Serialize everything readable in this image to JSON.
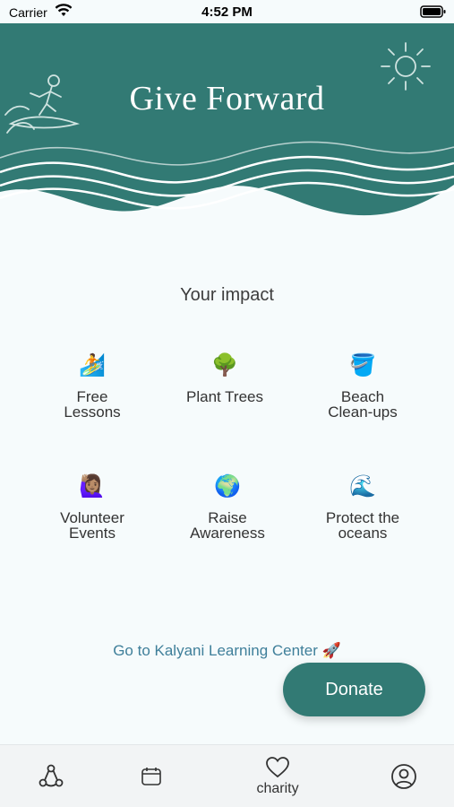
{
  "status": {
    "carrier": "Carrier",
    "time": "4:52 PM",
    "icons": [
      "wifi-icon",
      "battery-icon"
    ]
  },
  "header": {
    "title": "Give Forward",
    "background_color": "#327a74",
    "decorations": [
      "surfer-icon",
      "sun-icon",
      "wave-lines"
    ]
  },
  "impact": {
    "title": "Your impact",
    "items": [
      {
        "emoji": "🏄",
        "label_lines": [
          "Free",
          "Lessons"
        ]
      },
      {
        "emoji": "🌳",
        "label_lines": [
          "Plant Trees",
          ""
        ]
      },
      {
        "emoji": "🪣",
        "label_lines": [
          "Beach",
          "Clean-ups"
        ]
      },
      {
        "emoji": "🙋🏽‍♀️",
        "label_lines": [
          "Volunteer",
          "Events"
        ]
      },
      {
        "emoji": "🌍",
        "label_lines": [
          "Raise",
          "Awareness"
        ]
      },
      {
        "emoji": "🌊",
        "label_lines": [
          "Protect the",
          "oceans"
        ]
      }
    ]
  },
  "link": {
    "text": "Go to Kalyani Learning Center 🚀"
  },
  "donate": {
    "label": "Donate",
    "color": "#327a74"
  },
  "tabs": [
    {
      "icon": "community-icon",
      "label": ""
    },
    {
      "icon": "calendar-icon",
      "label": ""
    },
    {
      "icon": "heart-icon",
      "label": "charity"
    },
    {
      "icon": "profile-icon",
      "label": ""
    }
  ]
}
